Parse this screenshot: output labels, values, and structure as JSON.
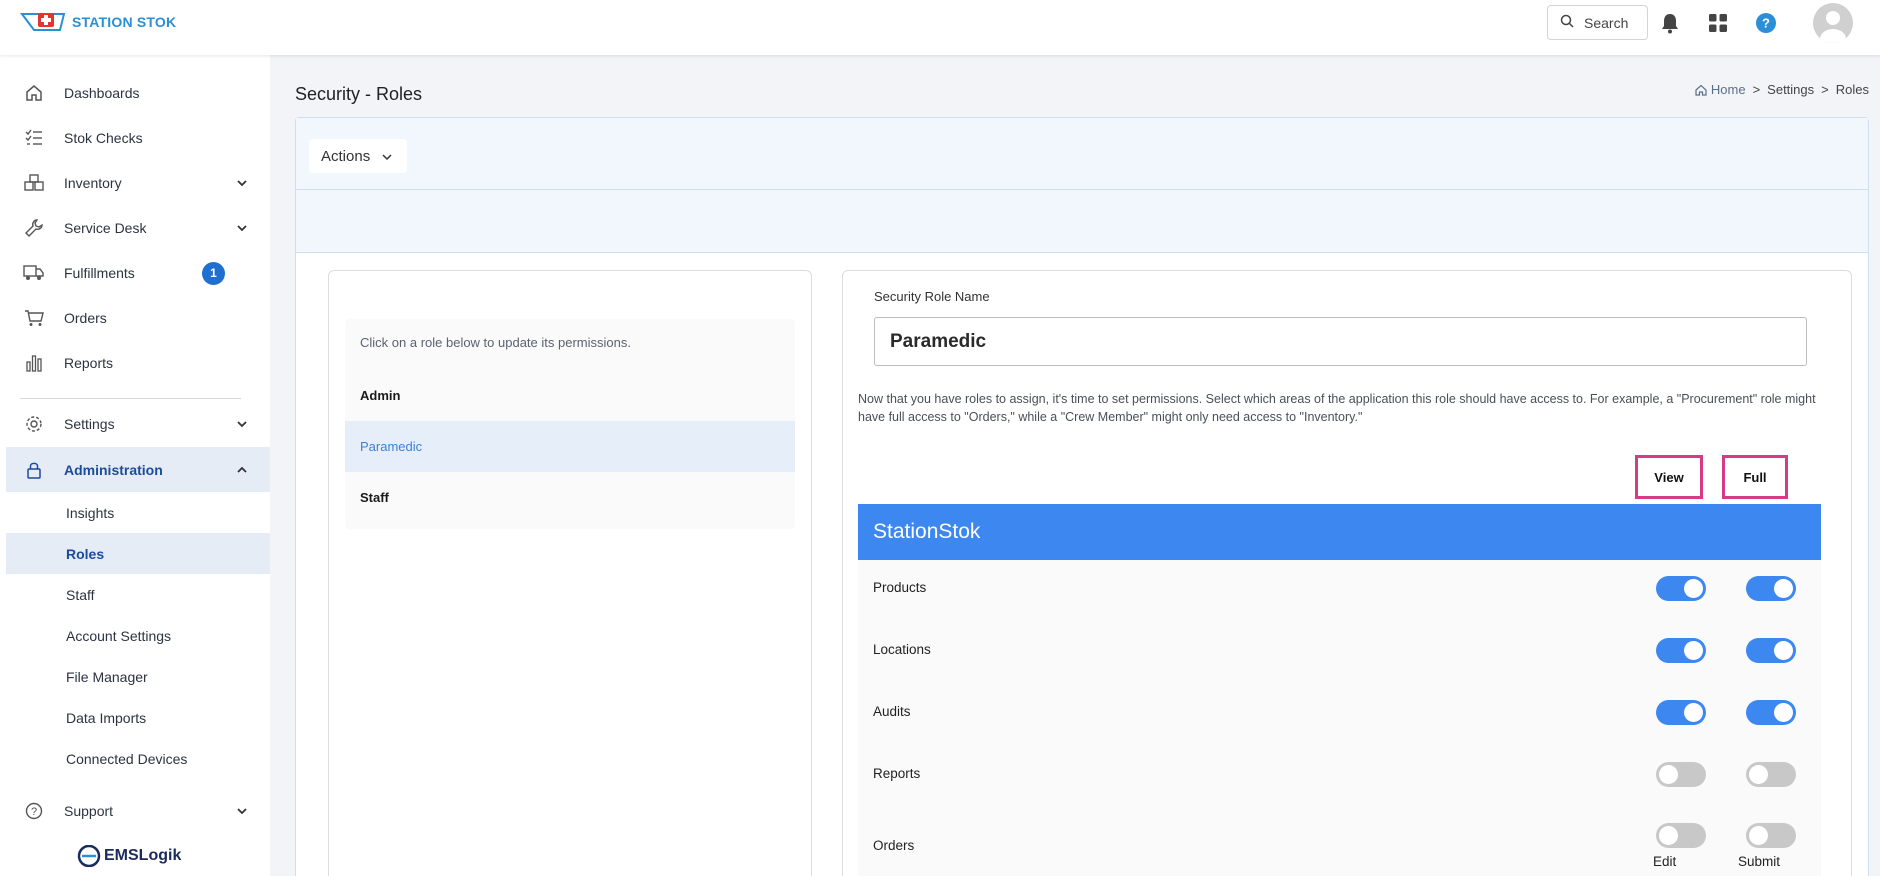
{
  "app": {
    "logo_text": "STATION STOK",
    "footer_logo": "EMSLogik"
  },
  "header": {
    "search_label": "Search",
    "icons": [
      "search-icon",
      "bell-icon",
      "apps-grid-icon",
      "help-icon",
      "avatar"
    ]
  },
  "sidebar": {
    "items": [
      {
        "label": "Dashboards",
        "icon": "home-icon"
      },
      {
        "label": "Stok Checks",
        "icon": "checklist-icon"
      },
      {
        "label": "Inventory",
        "icon": "boxes-icon"
      },
      {
        "label": "Service Desk",
        "icon": "wrench-icon"
      },
      {
        "label": "Fulfillments",
        "icon": "truck-icon",
        "badge": "1"
      },
      {
        "label": "Orders",
        "icon": "cart-icon"
      },
      {
        "label": "Reports",
        "icon": "bar-chart-icon"
      },
      {
        "label": "Settings",
        "icon": "gear-icon"
      },
      {
        "label": "Administration",
        "icon": "lock-icon"
      },
      {
        "label": "Support",
        "icon": "help-circle-icon"
      }
    ],
    "admin_sub": [
      "Insights",
      "Roles",
      "Staff",
      "Account Settings",
      "File Manager",
      "Data Imports",
      "Connected Devices"
    ]
  },
  "main": {
    "title": "Security - Roles",
    "breadcrumb": {
      "home": "Home",
      "settings": "Settings",
      "roles": "Roles",
      "sep": ">"
    },
    "actions_label": "Actions"
  },
  "roles": {
    "hint": "Click on a role below to update its permissions.",
    "items": [
      "Admin",
      "Paramedic",
      "Staff"
    ],
    "selected": "Paramedic"
  },
  "permissions": {
    "role_name_label": "Security Role Name",
    "role_name_value": "Paramedic",
    "description": "Now that you have roles to assign, it's time to set permissions. Select which areas of the application this role should have access to. For example, a \"Procurement\" role might have full access to \"Orders,\" while a \"Crew Member\" might only need access to \"Inventory.\"",
    "col_view": "View",
    "col_full": "Full",
    "section": "StationStok",
    "rows": [
      {
        "name": "Products",
        "view": true,
        "full": true
      },
      {
        "name": "Locations",
        "view": true,
        "full": true
      },
      {
        "name": "Audits",
        "view": true,
        "full": true
      },
      {
        "name": "Reports",
        "view": false,
        "full": false
      },
      {
        "name": "Orders",
        "view": false,
        "full": false
      }
    ],
    "orders_sub": {
      "edit": "Edit",
      "submit": "Submit"
    },
    "colors": {
      "accent": "#3d87f1",
      "highlight": "#d63b86",
      "off": "#c8c8c8"
    }
  }
}
